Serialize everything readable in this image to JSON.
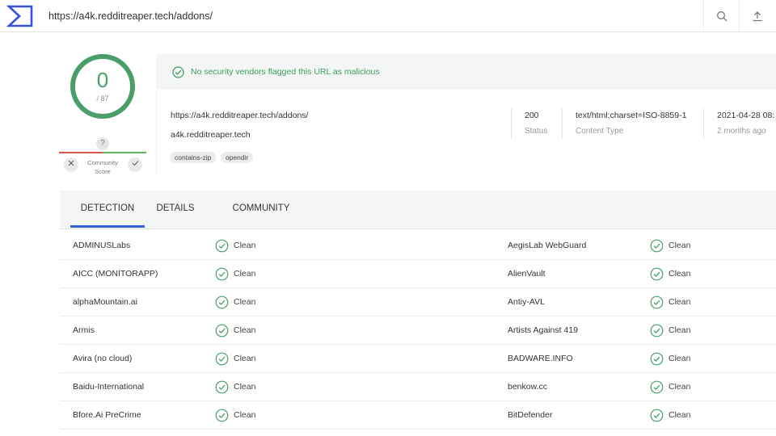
{
  "topbar": {
    "url": "https://a4k.redditreaper.tech/addons/",
    "search_icon": "search-icon",
    "upload_icon": "upload-icon"
  },
  "score": {
    "detections": "0",
    "total": "/ 87",
    "community_help": "?",
    "community_label_1": "Community",
    "community_label_2": "Score"
  },
  "banner": {
    "message": "No security vendors flagged this URL as malicious"
  },
  "info": {
    "url": "https://a4k.redditreaper.tech/addons/",
    "host": "a4k.redditreaper.tech",
    "tags": [
      "contains-zip",
      "opendir"
    ],
    "status_value": "200",
    "status_label": "Status",
    "content_type_value": "text/html;charset=ISO-8859-1",
    "content_type_label": "Content Type",
    "date_value": "2021-04-28 08:",
    "date_label": "2 months ago"
  },
  "tabs": {
    "detection": "DETECTION",
    "details": "DETAILS",
    "community": "COMMUNITY"
  },
  "detections": [
    {
      "left_engine": "ADMINUSLabs",
      "left_result": "Clean",
      "right_engine": "AegisLab WebGuard",
      "right_result": "Clean"
    },
    {
      "left_engine": "AICC (MONITORAPP)",
      "left_result": "Clean",
      "right_engine": "AlienVault",
      "right_result": "Clean"
    },
    {
      "left_engine": "alphaMountain.ai",
      "left_result": "Clean",
      "right_engine": "Antiy-AVL",
      "right_result": "Clean"
    },
    {
      "left_engine": "Armis",
      "left_result": "Clean",
      "right_engine": "Artists Against 419",
      "right_result": "Clean"
    },
    {
      "left_engine": "Avira (no cloud)",
      "left_result": "Clean",
      "right_engine": "BADWARE.INFO",
      "right_result": "Clean"
    },
    {
      "left_engine": "Baidu-International",
      "left_result": "Clean",
      "right_engine": "benkow.cc",
      "right_result": "Clean"
    },
    {
      "left_engine": "Bfore.Ai PreCrime",
      "left_result": "Clean",
      "right_engine": "BitDefender",
      "right_result": "Clean"
    }
  ],
  "colors": {
    "clean_green": "#4a9e6a",
    "tab_accent": "#3b61d7",
    "logo_blue": "#3b4fd9"
  }
}
